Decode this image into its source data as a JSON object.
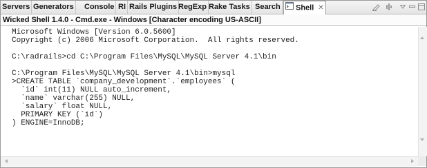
{
  "tabs": [
    {
      "label": "Servers"
    },
    {
      "label": "Generators"
    },
    {
      "label": "Console"
    },
    {
      "label": "RI"
    },
    {
      "label": "Rails Plugins"
    },
    {
      "label": "RegExp"
    },
    {
      "label": "Rake Tasks"
    },
    {
      "label": "Search"
    },
    {
      "label": "Shell",
      "active": true,
      "icon": "shell-icon",
      "close": "✕"
    }
  ],
  "view_menu_icons": [
    "clear-console-icon",
    "pin-icon",
    "view-menu-icon",
    "minimize-icon",
    "maximize-icon"
  ],
  "window_title": "Wicked Shell 1.4.0 - Cmd.exe - Windows [Character encoding US-ASCII]",
  "console_lines": [
    "Microsoft Windows [Version 6.0.5600]",
    "Copyright (c) 2006 Microsoft Corporation.  All rights reserved.",
    "",
    "C:\\radrails>cd C:\\Program Files\\MySQL\\MySQL Server 4.1\\bin",
    "",
    "C:\\Program Files\\MySQL\\MySQL Server 4.1\\bin>mysql",
    ">CREATE TABLE `company_development`.`employees` (",
    "  `id` int(11) NULL auto_increment,",
    "  `name` varchar(255) NULL,",
    "  `salary` float NULL,",
    "  PRIMARY KEY (`id`)",
    ") ENGINE=InnoDB;"
  ]
}
